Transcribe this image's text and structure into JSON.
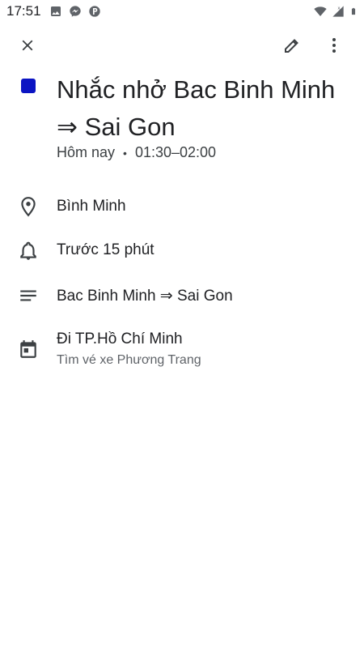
{
  "status_bar": {
    "time": "17:51",
    "left_icons": [
      "image-icon",
      "messenger-icon",
      "p-app-icon"
    ],
    "right_icons": [
      "wifi-icon",
      "signal-icon",
      "battery-icon"
    ]
  },
  "toolbar": {
    "close_icon": "close-icon",
    "edit_icon": "pencil-icon",
    "more_icon": "more-vert-icon"
  },
  "event": {
    "color": "#0b14c3",
    "title": "Nhắc nhở  Bac Binh Minh ⇒ Sai Gon",
    "date": "Hôm nay",
    "time_range": "01:30–02:00"
  },
  "details": {
    "location": "Bình Minh",
    "reminder": "Trước 15 phút",
    "description": "Bac Binh Minh ⇒ Sai Gon",
    "calendar_name": "Đi TP.Hồ Chí Minh",
    "calendar_sub": "Tìm vé xe Phương Trang"
  }
}
